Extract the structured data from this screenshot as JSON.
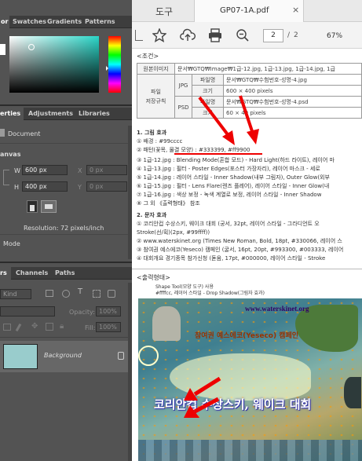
{
  "left_panel": {
    "color_tabs": [
      "or",
      "Swatches",
      "Gradients",
      "Patterns"
    ],
    "prop_tabs": [
      "erties",
      "Adjustments",
      "Libraries"
    ],
    "document_label": "Document",
    "canvas_heading": "anvas",
    "w_label": "W",
    "w_value": "600 px",
    "h_label": "H",
    "h_value": "400 px",
    "x_label": "X",
    "x_value": "0 px",
    "y_label": "Y",
    "y_value": "0 px",
    "resolution": "Resolution: 72 pixels/inch",
    "mode": "Mode",
    "layers_tabs": [
      "rs",
      "Channels",
      "Paths"
    ],
    "kind": "Kind",
    "opacity_label": "Opacity:",
    "opacity_value": "100%",
    "fill_label": "Fill:",
    "fill_value": "100%",
    "layer_name": "Background"
  },
  "viewer": {
    "tab_label": "도구",
    "file_title": "GP07-1A.pdf",
    "page_current": "2",
    "page_sep": "/",
    "page_total": "2",
    "zoom": "67%"
  },
  "doc": {
    "heading1": "<조건>",
    "rows": [
      {
        "a": "원본이미지",
        "b": "",
        "c": "문서₩GTQ₩Image₩1급-12.jpg, 1급-13.jpg, 1급-14.jpg, 1급"
      },
      {
        "a": "",
        "b": "",
        "c": "파일명",
        "d": "문서₩GTQ₩수험번호-성명-4.jpg"
      },
      {
        "a": "파일",
        "b": "JPG",
        "c": "크기",
        "d": "600 × 400 pixels"
      },
      {
        "a": "저장규칙",
        "b": "",
        "c": "파일명",
        "d": "문서₩GTQ₩수험번호-성명-4.psd"
      },
      {
        "a": "",
        "b": "PSD",
        "c": "크기",
        "d": "60 × 40 pixels"
      }
    ],
    "section1": "1. 그림 효과",
    "items1": [
      "① 배경 : #99cccc",
      "② 패턴(꽃목, 물결 모양) : #333399, #ff9900",
      "③ 1급-12.jpg : Blending Mode(혼합 모드) - Hard Light(하드 라이트), 레이어 마",
      "④ 1급-13.jpg : 필터 - Poster Edges(포스터 가장자리), 레이어 마스크 - 세로",
      "⑤ 1급-14.jpg : 레이어 스타일 - Inner Shadow(내부 그림자), Outer Glow(외부",
      "⑥ 1급-15.jpg : 필터 - Lens Flare(렌즈 플레어), 레이어 스타일 - Inner Glow(내",
      "⑦ 1급-16.jpg : 색상 보정 - 녹색 계열로 보정, 레이어 스타일 - Inner Shadow",
      "⑧ 그 외 《출력형태》 참조"
    ],
    "section2": "2. 문자 효과",
    "items2": [
      "① 코리안컵 수상스키, 웨이크 대회 (궁서, 32pt, 레이어 스타일 - 그라디언트 오",
      "   Stroke(선/획)(2px, #99ffff))",
      "② www.waterskinet.org (Times New Roman, Bold, 18pt, #330066, 레이어 스",
      "③ 참여권 예스에코(Yeseco) 캠페인 (굴서, 16pt, 20pt, #993300, #003333, 레이어",
      "④ 대회개요 경기종목 참가신청 (돋움, 17pt, #000000, 레이어 스타일 - Stroke"
    ],
    "output_heading": "<출력형태>",
    "shape_note1": "Shape Tool(모양 도구) 사용",
    "shape_note2": "#ffffcc, 레이어 스타일 - Drop Shadow(그림자 효과)",
    "img_url": "www.waterskinet.org",
    "img_campaign": "참여권 예스에코(Yeseco) 캠페인",
    "img_title": "코리안컵 수상스키, 웨이크 대회"
  }
}
